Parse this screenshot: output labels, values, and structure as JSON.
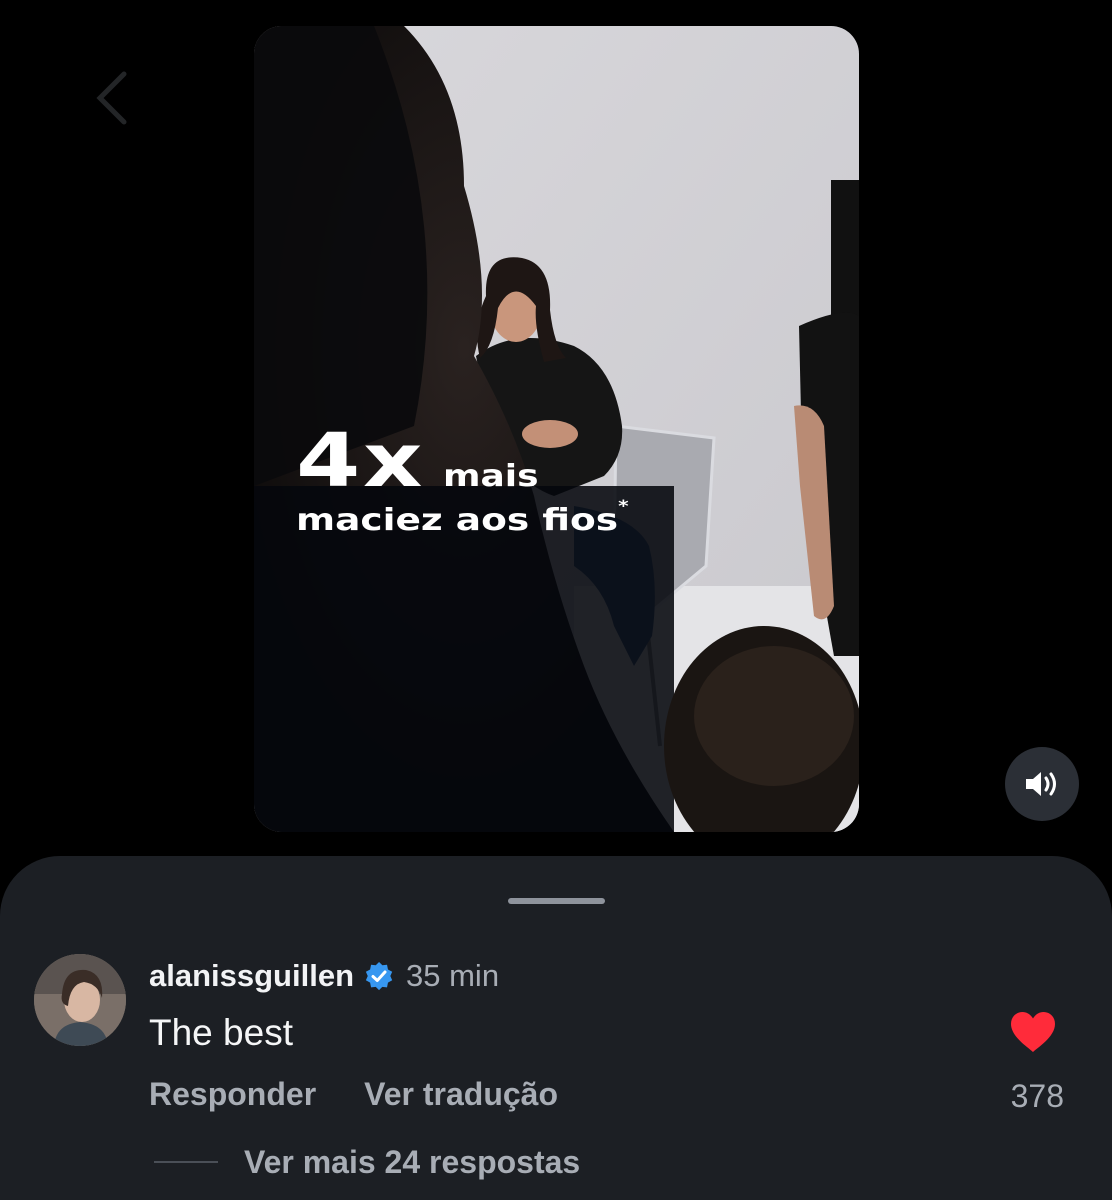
{
  "video": {
    "headline_big": "4x",
    "headline_small": "mais",
    "headline_line2": "maciez aos fios",
    "footnote_mark": "*"
  },
  "controls": {
    "sound_icon": "speaker-volume-icon",
    "back_icon": "chevron-left-icon"
  },
  "comment": {
    "username": "alanissguillen",
    "verified_icon": "verified-badge-icon",
    "time": "35 min",
    "text": "The best",
    "reply_label": "Responder",
    "translate_label": "Ver tradução",
    "like_count": "378",
    "liked": true,
    "more_replies_label": "Ver mais 24 respostas"
  },
  "colors": {
    "background": "#000000",
    "sheet": "#1c1f24",
    "like_red": "#ff2b3a",
    "verified_blue": "#3797f0",
    "muted_text": "#a8adb5"
  }
}
